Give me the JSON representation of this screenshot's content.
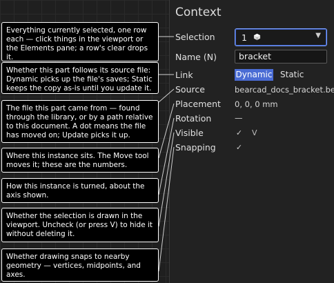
{
  "panel": {
    "title": "Context",
    "rows": {
      "selection_label": "Selection",
      "selection_value": "1",
      "name_label": "Name (N)",
      "name_value": "bracket",
      "link_label": "Link",
      "link_dynamic": "Dynamic",
      "link_static": "Static",
      "source_label": "Source",
      "source_value": "bearcad_docs_bracket.be...",
      "placement_label": "Placement",
      "placement_value": "0, 0, 0 mm",
      "rotation_label": "Rotation",
      "rotation_value": "—",
      "visible_label": "Visible",
      "visible_shortcut": "V",
      "snapping_label": "Snapping"
    }
  },
  "tooltips": [
    "Everything currently selected, one row each — click things in the viewport or the Elements pane; a row's clear drops it.",
    "Whether this part follows its source file: Dynamic picks up the file's saves; Static keeps the copy as-is until you update it.",
    "The file this part came from — found through the library, or by a path relative to this document. A dot means the file has moved on; Update picks it up.",
    "Where this instance sits. The Move tool moves it; these are the numbers.",
    "How this instance is turned, about the axis shown.",
    "Whether the selection is drawn in the viewport. Uncheck (or press V) to hide it without deleting it.",
    "Whether drawing snaps to nearby geometry — vertices, midpoints, and axes."
  ],
  "colors": {
    "accent": "#4a6cd4",
    "focus_border": "#7da2ff",
    "tooltip_bg": "#000000"
  },
  "icons": {
    "selection_item": "cube-icon",
    "dropdown": "chevron-down-icon",
    "check": "checkmark-icon"
  }
}
